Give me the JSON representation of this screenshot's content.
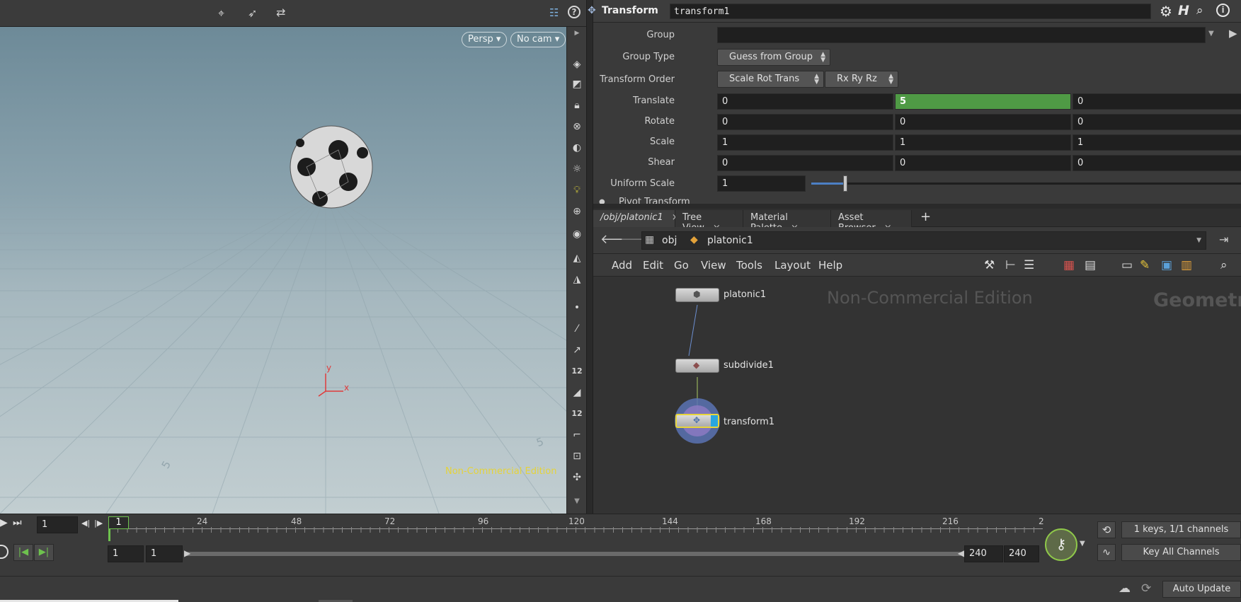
{
  "viewport": {
    "camera_view": "Persp",
    "camera_select": "No cam",
    "watermark": "Non-Commercial Edition",
    "axis_x": "x",
    "axis_y": "y",
    "grid_labels": [
      "5",
      "5"
    ]
  },
  "parameters": {
    "node_type": "Transform",
    "node_name": "transform1",
    "group_label": "Group",
    "group_value": "",
    "group_type_label": "Group Type",
    "group_type_value": "Guess from Group",
    "transform_order_label": "Transform Order",
    "transform_order_value": "Scale Rot Trans",
    "rotate_order_value": "Rx Ry Rz",
    "translate_label": "Translate",
    "translate": [
      "0",
      "5",
      "0"
    ],
    "rotate_label": "Rotate",
    "rotate": [
      "0",
      "0",
      "0"
    ],
    "scale_label": "Scale",
    "scale": [
      "1",
      "1",
      "1"
    ],
    "shear_label": "Shear",
    "shear": [
      "0",
      "0",
      "0"
    ],
    "uniform_scale_label": "Uniform Scale",
    "uniform_scale_value": "1",
    "uniform_scale_fraction": 0.079,
    "pivot_label": "Pivot Transform"
  },
  "network": {
    "tabs": [
      {
        "label": "/obj/platonic1"
      },
      {
        "label": "Tree View"
      },
      {
        "label": "Material Palette"
      },
      {
        "label": "Asset Browser"
      }
    ],
    "path_obj": "obj",
    "path_node": "platonic1",
    "menu": [
      "Add",
      "Edit",
      "Go",
      "View",
      "Tools",
      "Layout",
      "Help"
    ],
    "watermark": "Non-Commercial Edition",
    "context_label": "Geometr",
    "nodes": [
      {
        "name": "platonic1"
      },
      {
        "name": "subdivide1"
      },
      {
        "name": "transform1"
      }
    ]
  },
  "timeline": {
    "current_frame": "1",
    "frame_marker": "1",
    "ticks": [
      "24",
      "48",
      "72",
      "96",
      "120",
      "144",
      "168",
      "192",
      "216",
      "2"
    ],
    "range_start": "1",
    "range_start2": "1",
    "range_end": "240",
    "range_end2": "240",
    "keys_status": "1 keys, 1/1 channels",
    "key_all_label": "Key All Channels"
  },
  "status": {
    "auto_update": "Auto Update"
  },
  "colors": {
    "active_field": "#4f9a45",
    "watermark_viewport": "#e5d33a",
    "node_highlight": "#e8d53a"
  }
}
